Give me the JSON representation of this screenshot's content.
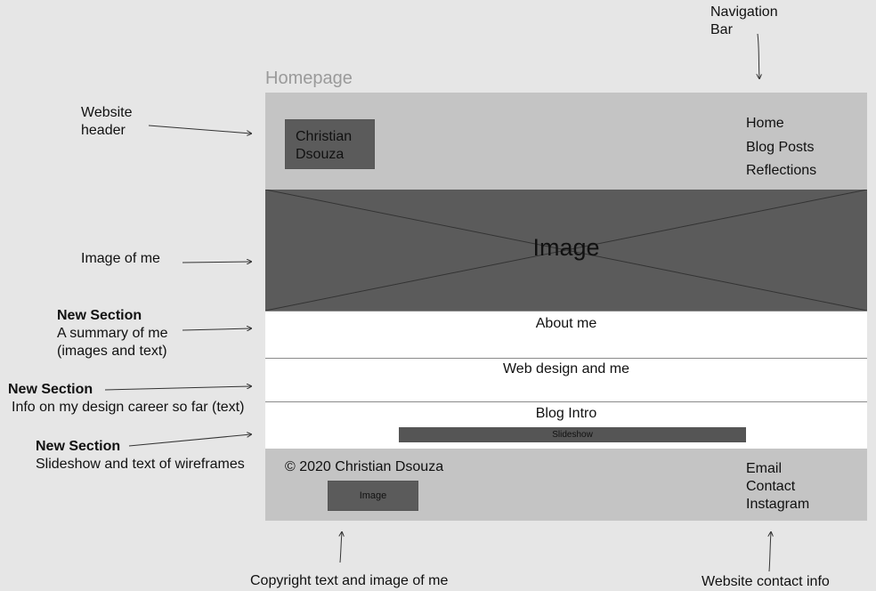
{
  "page_title": "Homepage",
  "header": {
    "logo_text": "Christian Dsouza",
    "nav": [
      "Home",
      "Blog Posts",
      "Reflections"
    ]
  },
  "hero": {
    "label": "Image"
  },
  "sections": {
    "about": "About me",
    "web_design": "Web design and me",
    "blog_intro": "Blog Intro",
    "slideshow": "Slideshow"
  },
  "footer": {
    "copyright": "© 2020 Christian Dsouza",
    "image_label": "Image",
    "contact": [
      "Email",
      "Contact",
      "Instagram"
    ]
  },
  "annotations": {
    "navigation_bar": [
      "Navigation",
      "Bar"
    ],
    "website_header": [
      "Website",
      "header"
    ],
    "image_of_me": "Image of me",
    "new_section_1": {
      "title": "New Section",
      "lines": [
        "A summary of me",
        "(images and text)"
      ]
    },
    "new_section_2": {
      "title": "New Section",
      "lines": [
        "Info on my design career so far (text)"
      ]
    },
    "new_section_3": {
      "title": "New Section",
      "lines": [
        "Slideshow and text of wireframes"
      ]
    },
    "copyright_note": "Copyright text and image of me",
    "contact_note": "Website contact info"
  }
}
